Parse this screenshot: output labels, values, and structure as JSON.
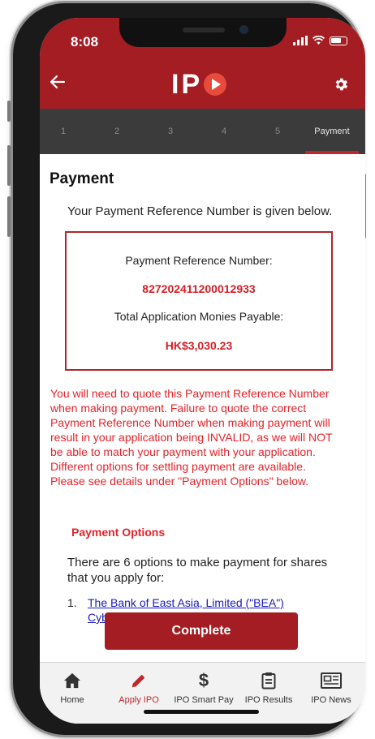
{
  "status_bar": {
    "time": "8:08"
  },
  "header": {
    "logo_text": "IP",
    "back_icon": "back-arrow-icon",
    "settings_icon": "gear-icon"
  },
  "steps": [
    "1",
    "2",
    "3",
    "4",
    "5",
    "Payment"
  ],
  "active_step": "Payment",
  "content": {
    "title": "Payment",
    "intro": "Your Payment Reference Number is given below.",
    "ref_label": "Payment Reference Number:",
    "ref_number": "827202411200012933",
    "total_label": "Total Application Monies Payable:",
    "total_amount": "HK$3,030.23",
    "warning": "You will need to quote this Payment Reference Number when making payment. Failure to quote the correct Payment Reference Number when making payment will result in your application being INVALID, as we will NOT be able to match your payment with your application. Different options for settling payment are available. Please see details under \"Payment Options\" below.",
    "options_heading": "Payment Options",
    "options_intro": "There are 6 options to make payment for shares that you apply for:",
    "options": [
      {
        "number": "1.",
        "label": "The Bank of East Asia, Limited (\"BEA\") Cyberbanking Bill Payment Service"
      }
    ]
  },
  "complete_button": "Complete",
  "tabs": [
    {
      "label": "Home",
      "icon": "home-icon"
    },
    {
      "label": "Apply IPO",
      "icon": "pencil-icon"
    },
    {
      "label": "IPO Smart Pay",
      "icon": "dollar-icon"
    },
    {
      "label": "IPO Results",
      "icon": "clipboard-icon"
    },
    {
      "label": "IPO News",
      "icon": "newspaper-icon"
    }
  ],
  "active_tab": "Apply IPO",
  "colors": {
    "brand": "#a31d22",
    "accent_red": "#e3232a",
    "link": "#1a1bb8",
    "steps_bg": "#3b3b3b"
  }
}
